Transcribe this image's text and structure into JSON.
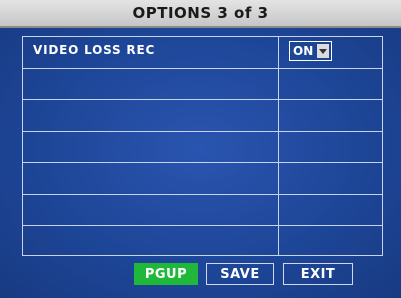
{
  "title": "OPTIONS 3 of 3",
  "options": {
    "rows": [
      {
        "label": "VIDEO LOSS REC",
        "value": "ON"
      },
      {
        "label": "",
        "value": ""
      },
      {
        "label": "",
        "value": ""
      },
      {
        "label": "",
        "value": ""
      },
      {
        "label": "",
        "value": ""
      },
      {
        "label": "",
        "value": ""
      },
      {
        "label": "",
        "value": ""
      }
    ]
  },
  "buttons": {
    "pgup": "PGUP",
    "save": "SAVE",
    "exit": "EXIT"
  },
  "colors": {
    "background": "#1c3f8a",
    "active_button": "#1fb83a",
    "grid_lines": "#c8d4ee"
  }
}
